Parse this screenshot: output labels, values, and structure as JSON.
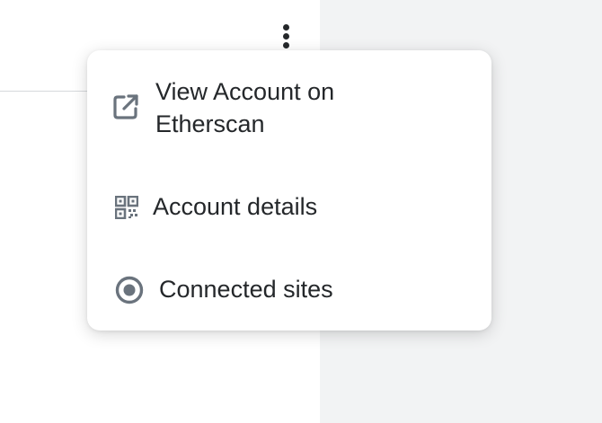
{
  "menu": {
    "items": [
      {
        "label": "View Account on Etherscan",
        "icon": "external-link-icon"
      },
      {
        "label": "Account details",
        "icon": "qr-code-icon"
      },
      {
        "label": "Connected sites",
        "icon": "connected-sites-icon"
      }
    ]
  },
  "header": {
    "menu_button_icon": "kebab-menu-icon"
  },
  "colors": {
    "text": "#24272a",
    "icon": "#6a737d",
    "menu_bg": "#ffffff",
    "page_bg": "#f2f3f4"
  }
}
